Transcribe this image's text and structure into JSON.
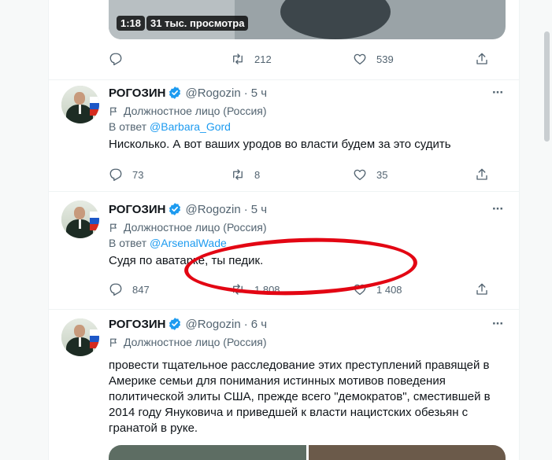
{
  "top_tweet": {
    "video_duration": "1:18",
    "video_views": "31 тыс. просмотра",
    "replies": "",
    "retweets": "212",
    "likes": "539"
  },
  "tweets": [
    {
      "author": "РОГОЗИН",
      "handle": "@Rogozin",
      "dot": "·",
      "time": "5 ч",
      "label": "Должностное лицо (Россия)",
      "reply_prefix": "В ответ",
      "reply_to": "@Barbara_Gord",
      "text": "Нисколько. А вот ваших уродов во власти будем за это судить",
      "replies": "73",
      "retweets": "8",
      "likes": "35"
    },
    {
      "author": "РОГОЗИН",
      "handle": "@Rogozin",
      "dot": "·",
      "time": "5 ч",
      "label": "Должностное лицо (Россия)",
      "reply_prefix": "В ответ",
      "reply_to": "@ArsenalWade",
      "text": "Судя по аватарке, ты педик.",
      "replies": "847",
      "retweets": "1 808",
      "likes": "1 408"
    },
    {
      "author": "РОГОЗИН",
      "handle": "@Rogozin",
      "dot": "·",
      "time": "6 ч",
      "label": "Должностное лицо (Россия)",
      "text": "провести тщательное расследование этих преступлений правящей в Америке семьи для понимания истинных мотивов поведения политической элиты США, прежде всего \"демократов\", сместившей в 2014 году Януковича и приведшей к власти нацистских обезьян с гранатой в руке."
    }
  ],
  "colors": {
    "accent": "#1d9bf0",
    "secondary_text": "#536471",
    "annotation": "#e30613"
  },
  "icons": [
    "reply-icon",
    "retweet-icon",
    "like-icon",
    "share-icon",
    "verified-icon",
    "flag-icon",
    "more-icon"
  ]
}
